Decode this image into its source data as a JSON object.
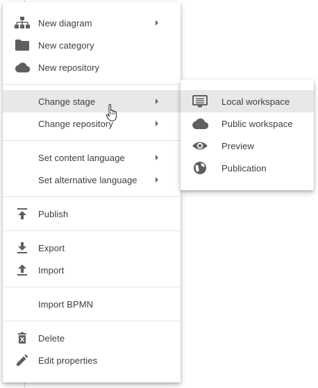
{
  "main_menu": {
    "new_diagram": {
      "label": "New diagram",
      "icon": "sitemap-icon"
    },
    "new_category": {
      "label": "New category",
      "icon": "folder-icon"
    },
    "new_repository": {
      "label": "New repository",
      "icon": "cloud-icon"
    },
    "change_stage": {
      "label": "Change stage"
    },
    "change_repository": {
      "label": "Change repository"
    },
    "set_content_language": {
      "label": "Set content language"
    },
    "set_alternative_language": {
      "label": "Set alternative language"
    },
    "publish": {
      "label": "Publish",
      "icon": "publish-icon"
    },
    "export": {
      "label": "Export",
      "icon": "download-icon"
    },
    "import": {
      "label": "Import",
      "icon": "upload-icon"
    },
    "import_bpmn": {
      "label": "Import BPMN"
    },
    "delete": {
      "label": "Delete",
      "icon": "trash-icon"
    },
    "edit_properties": {
      "label": "Edit properties",
      "icon": "pencil-icon"
    }
  },
  "stage_submenu": {
    "local_workspace": {
      "label": "Local workspace",
      "icon": "monitor-list-icon"
    },
    "public_workspace": {
      "label": "Public workspace",
      "icon": "cloud-icon"
    },
    "preview": {
      "label": "Preview",
      "icon": "eye-icon"
    },
    "publication": {
      "label": "Publication",
      "icon": "globe-icon"
    }
  },
  "colors": {
    "icon": "#5f5f5f",
    "active_bg": "#e8e8e8",
    "divider": "#e3e3e3"
  }
}
